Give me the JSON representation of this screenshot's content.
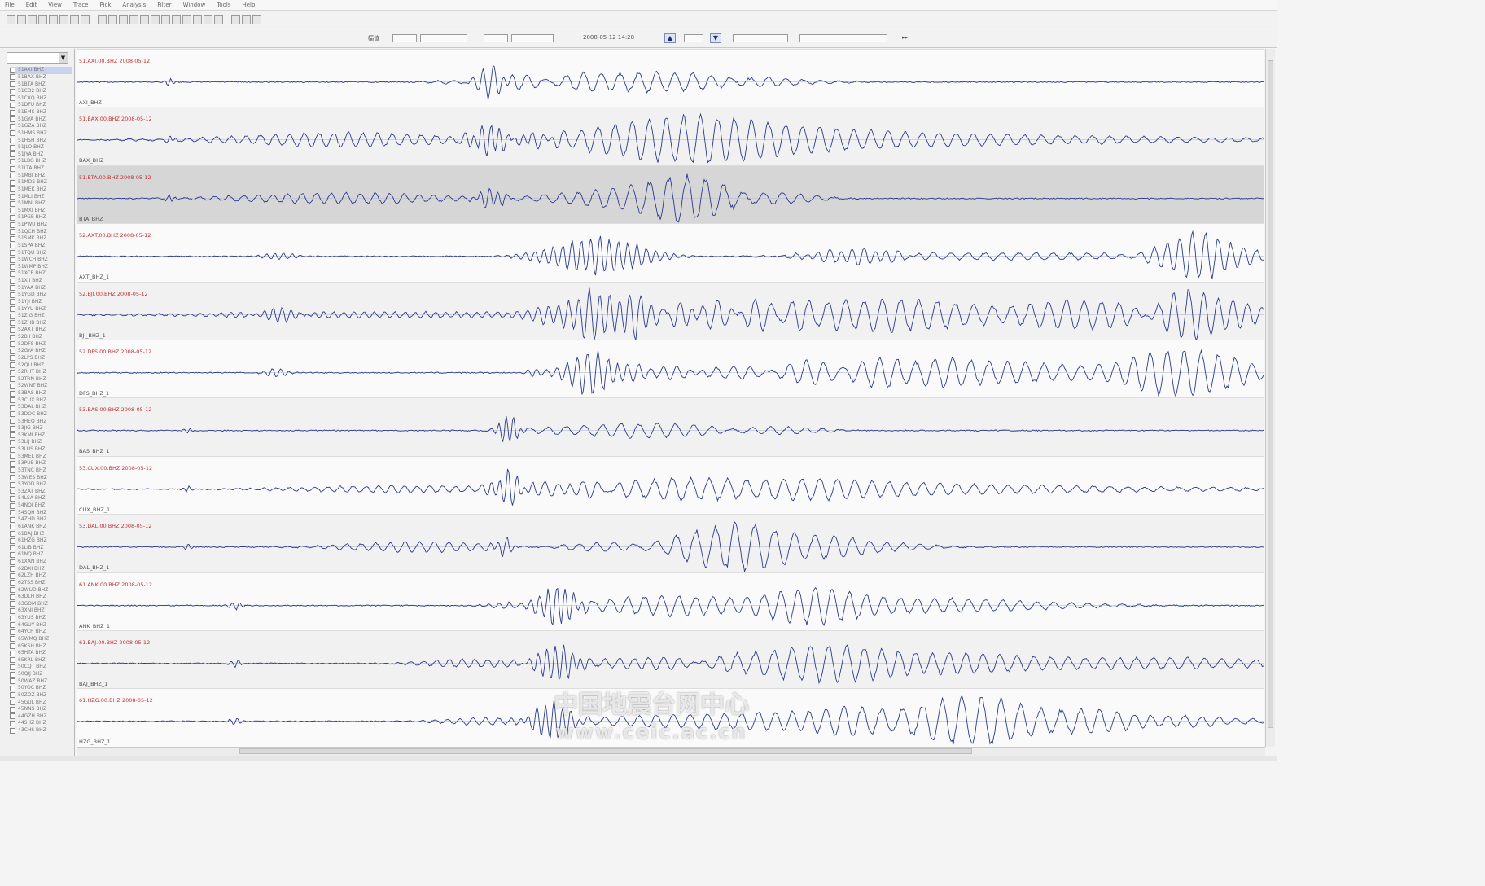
{
  "menubar": {
    "items": [
      "File",
      "Edit",
      "View",
      "Trace",
      "Pick",
      "Analysis",
      "Filter",
      "Window",
      "Tools",
      "Help"
    ]
  },
  "toolbar": {
    "icons": [
      "open-icon",
      "save-icon",
      "print-icon",
      "zoom-in-icon",
      "zoom-out-icon",
      "pan-icon",
      "select-icon",
      "fit-icon",
      "sep",
      "cursor-icon",
      "pick-p-icon",
      "pick-s-icon",
      "marker-icon",
      "filter-icon",
      "spectrum-icon",
      "rotate-icon",
      "align-icon",
      "stack-icon",
      "gain-up-icon",
      "gain-down-icon",
      "clip-icon",
      "sep",
      "play-icon",
      "stop-icon",
      "record-icon"
    ]
  },
  "filterbar": {
    "amp_label": "幅值",
    "time_value": "2008-05-12 14:28",
    "up_button": "▲",
    "down_button": "▼",
    "right_text": "▸▸"
  },
  "sidebar": {
    "selected_station": "",
    "stations": [
      "51AXI BHZ",
      "51BAX BHZ",
      "51BTA BHZ",
      "51CD2 BHZ",
      "51CXQ BHZ",
      "51DFU BHZ",
      "51EMS BHZ",
      "51GYA BHZ",
      "51GZA BHZ",
      "51HMS BHZ",
      "51HSH BHZ",
      "51JLO BHZ",
      "51JYA BHZ",
      "51LBO BHZ",
      "51LTA BHZ",
      "51MBI BHZ",
      "51MDS BHZ",
      "51MEK BHZ",
      "51MLI BHZ",
      "51MNI BHZ",
      "51MXI BHZ",
      "51PGE BHZ",
      "51PWU BHZ",
      "51QCH BHZ",
      "51SMK BHZ",
      "51SPA BHZ",
      "51TQU BHZ",
      "51WCH BHZ",
      "51WMP BHZ",
      "51XCE BHZ",
      "51XJI BHZ",
      "51YAA BHZ",
      "51YGD BHZ",
      "51YJI BHZ",
      "51YYU BHZ",
      "51ZJG BHZ",
      "51ZHB BHZ",
      "52AXT BHZ",
      "52BJI BHZ",
      "52DFS BHZ",
      "52GYA BHZ",
      "52LPS BHZ",
      "52QLI BHZ",
      "52RHT BHZ",
      "52TRN BHZ",
      "52WNT BHZ",
      "53BAS BHZ",
      "53CUX BHZ",
      "53DAL BHZ",
      "53DOC BHZ",
      "53HEQ BHZ",
      "53JIG BHZ",
      "53KMI BHZ",
      "53LIJ BHZ",
      "53LUS BHZ",
      "53MEL BHZ",
      "53PUE BHZ",
      "53TNC BHZ",
      "53WES BHZ",
      "53YOD BHZ",
      "53ZAT BHZ",
      "54LSA BHZ",
      "54NQI BHZ",
      "54SQH BHZ",
      "54ZHD BHZ",
      "61ANK BHZ",
      "61BAJ BHZ",
      "61HZG BHZ",
      "61LIB BHZ",
      "61NQ BHZ",
      "61XAN BHZ",
      "62DXI BHZ",
      "62LZH BHZ",
      "62TSS BHZ",
      "62WUD BHZ",
      "63DLH BHZ",
      "63GOM BHZ",
      "63XNI BHZ",
      "63YUS BHZ",
      "64GUY BHZ",
      "64YCH BHZ",
      "65WMQ BHZ",
      "65KSH BHZ",
      "65HTA BHZ",
      "65KRL BHZ",
      "50CQT BHZ",
      "50QIJ BHZ",
      "50WAZ BHZ",
      "50YOC BHZ",
      "50ZOZ BHZ",
      "45GUL BHZ",
      "45NNS BHZ",
      "44GZH BHZ",
      "44SHZ BHZ",
      "43CHS BHZ"
    ]
  },
  "traces": [
    {
      "time": "51.AXI.00.BHZ  2008-05-12",
      "name": "AXI_BHZ",
      "style": "normal"
    },
    {
      "time": "51.BAX.00.BHZ  2008-05-12",
      "name": "BAX_BHZ",
      "style": "alt"
    },
    {
      "time": "51.BTA.00.BHZ  2008-05-12",
      "name": "BTA_BHZ",
      "style": "active"
    },
    {
      "time": "52.AXT.00.BHZ  2008-05-12",
      "name": "AXT_BHZ_1",
      "style": "normal"
    },
    {
      "time": "52.BJI.00.BHZ  2008-05-12",
      "name": "BJI_BHZ_1",
      "style": "alt"
    },
    {
      "time": "52.DFS.00.BHZ  2008-05-12",
      "name": "DFS_BHZ_1",
      "style": "normal"
    },
    {
      "time": "53.BAS.00.BHZ  2008-05-12",
      "name": "BAS_BHZ_1",
      "style": "alt"
    },
    {
      "time": "53.CUX.00.BHZ  2008-05-12",
      "name": "CUX_BHZ_1",
      "style": "normal"
    },
    {
      "time": "53.DAL.00.BHZ  2008-05-12",
      "name": "DAL_BHZ_1",
      "style": "alt"
    },
    {
      "time": "61.ANK.00.BHZ  2008-05-12",
      "name": "ANK_BHZ_1",
      "style": "normal"
    },
    {
      "time": "61.BAJ.00.BHZ  2008-05-12",
      "name": "BAJ_BHZ_1",
      "style": "alt"
    },
    {
      "time": "61.HZG.00.BHZ  2008-05-12",
      "name": "HZG_BHZ_1",
      "style": "normal"
    }
  ],
  "watermark": {
    "line1": "中国地震台网中心",
    "line2": "www.ceic.ac.cn"
  },
  "colors": {
    "trace": "#2b3a8c",
    "pick": "#c03030"
  }
}
